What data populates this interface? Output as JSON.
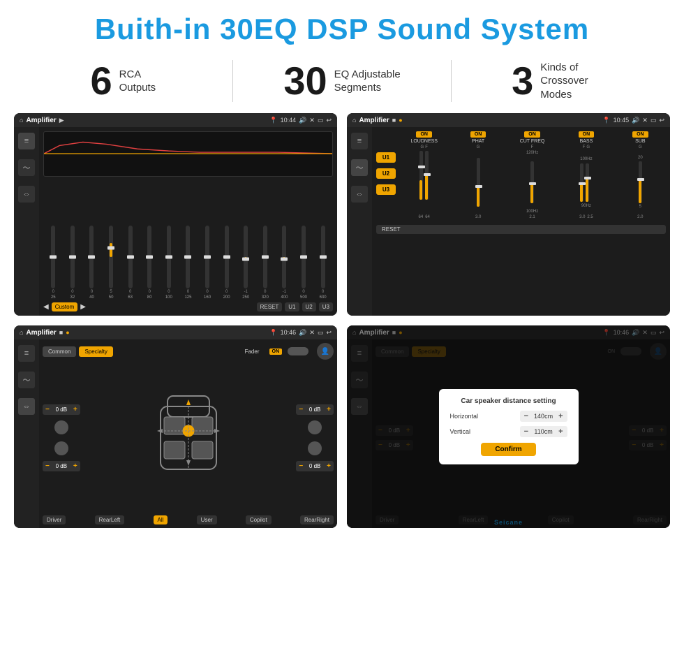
{
  "header": {
    "title": "Buith-in 30EQ DSP Sound System"
  },
  "stats": [
    {
      "number": "6",
      "desc_line1": "RCA",
      "desc_line2": "Outputs"
    },
    {
      "number": "30",
      "desc_line1": "EQ Adjustable",
      "desc_line2": "Segments"
    },
    {
      "number": "3",
      "desc_line1": "Kinds of",
      "desc_line2": "Crossover Modes"
    }
  ],
  "screen1": {
    "app_name": "Amplifier",
    "time": "10:44",
    "eq_bands": [
      "25",
      "32",
      "40",
      "50",
      "63",
      "80",
      "100",
      "125",
      "160",
      "200",
      "250",
      "320",
      "400",
      "500",
      "630"
    ],
    "eq_values": [
      "0",
      "0",
      "0",
      "5",
      "0",
      "0",
      "0",
      "0",
      "0",
      "0",
      "-1",
      "0",
      "-1",
      "0",
      "0"
    ],
    "bottom_btns": [
      "Custom",
      "RESET",
      "U1",
      "U2",
      "U3"
    ]
  },
  "screen2": {
    "app_name": "Amplifier",
    "time": "10:45",
    "presets": [
      "U1",
      "U2",
      "U3"
    ],
    "channels": [
      {
        "label": "LOUDNESS",
        "on": true
      },
      {
        "label": "PHAT",
        "on": true
      },
      {
        "label": "CUT FREQ",
        "on": true
      },
      {
        "label": "BASS",
        "on": true
      },
      {
        "label": "SUB",
        "on": true
      }
    ],
    "reset_label": "RESET"
  },
  "screen3": {
    "app_name": "Amplifier",
    "time": "10:46",
    "tabs": [
      "Common",
      "Specialty"
    ],
    "fader_label": "Fader",
    "fader_on": "ON",
    "volumes": [
      {
        "label": "0 dB"
      },
      {
        "label": "0 dB"
      },
      {
        "label": "0 dB"
      },
      {
        "label": "0 dB"
      }
    ],
    "bottom_btns": [
      "Driver",
      "RearLeft",
      "All",
      "User",
      "Copilot",
      "RearRight"
    ]
  },
  "screen4": {
    "app_name": "Amplifier",
    "time": "10:46",
    "tabs": [
      "Common",
      "Specialty"
    ],
    "dialog": {
      "title": "Car speaker distance setting",
      "horizontal_label": "Horizontal",
      "horizontal_value": "140cm",
      "vertical_label": "Vertical",
      "vertical_value": "110cm",
      "confirm_label": "Confirm"
    },
    "bottom_btns": [
      "Driver",
      "RearLeft",
      "Copilot",
      "RearRight"
    ]
  },
  "watermark": "Seicane"
}
